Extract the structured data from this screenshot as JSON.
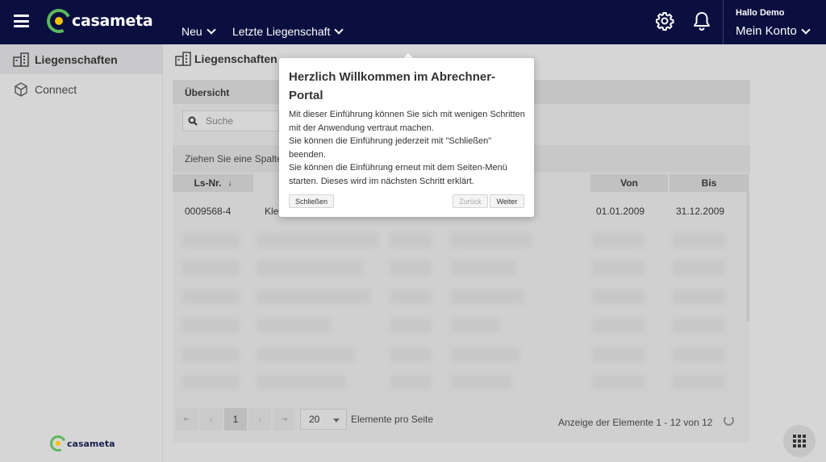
{
  "topbar": {
    "logo_text": "casameta",
    "nav": [
      {
        "label": "Neu"
      },
      {
        "label": "Letzte Liegenschaft"
      }
    ],
    "greeting": "Hallo Demo",
    "account_label": "Mein Konto"
  },
  "sidebar": {
    "items": [
      {
        "label": "Liegenschaften",
        "icon": "buildings-icon",
        "active": true
      },
      {
        "label": "Connect",
        "icon": "cube-icon",
        "active": false
      }
    ],
    "footer_logo_text": "casameta"
  },
  "main": {
    "page_title": "Liegenschaften",
    "panel_title": "Übersicht",
    "search_placeholder": "Suche",
    "group_hint": "Ziehen Sie eine Spalter",
    "columns": {
      "ls_nr": "Ls-Nr.",
      "von": "Von",
      "bis": "Bis"
    },
    "row": {
      "ls_nr": "0009568-4",
      "name": "Klei",
      "von": "01.01.2009",
      "bis": "31.12.2009"
    },
    "pager": {
      "first": "⇤",
      "prev": "‹",
      "current": "1",
      "next": "›",
      "last": "⇥",
      "page_size": "20",
      "per_page_label": "Elemente pro Seite",
      "count_label": "Anzeige der Elemente 1 - 12 von 12"
    }
  },
  "tour": {
    "title": "Herzlich Willkommen im Abrechner-Portal",
    "text": "Mit dieser Einführung können Sie sich mit wenigen Schritten mit der Anwendung vertraut machen.\nSie können die Einführung jederzeit mit \"Schließen\" beenden.\nSie können die Einführung erneut mit dem Seiten-Menü starten. Dieses wird im nächsten Schritt erklärt.",
    "close_label": "Schließen",
    "back_label": "Zurück",
    "next_label": "Weiter"
  },
  "colors": {
    "topbar_bg": "#0a0f3f",
    "logo_green": "#5cb85c",
    "logo_yellow": "#f2c200"
  }
}
